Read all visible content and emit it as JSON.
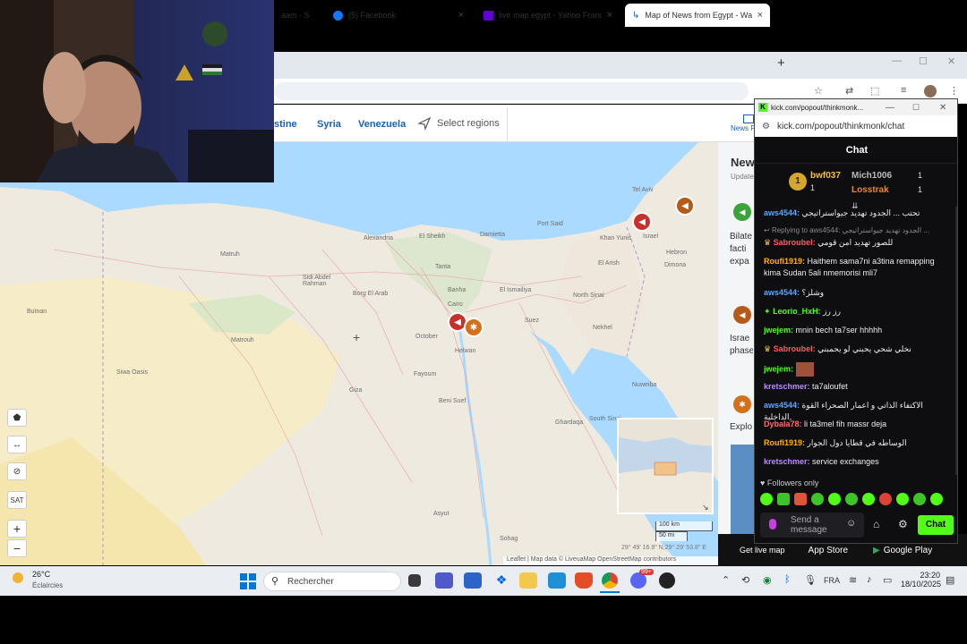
{
  "browser": {
    "tabs": [
      {
        "label": "aam · S",
        "active": false
      },
      {
        "label": "(5) Facebook",
        "active": false
      },
      {
        "label": "live map egypt - Yahoo France",
        "active": false
      },
      {
        "label": "Map of News from Egypt - Wa",
        "active": true
      }
    ],
    "new_tab": "+"
  },
  "liveuamap": {
    "nav": [
      "stine",
      "Syria",
      "Venezuela"
    ],
    "select_regions": "Select regions",
    "news_heading": "New",
    "news_tab": "News F",
    "news_items": [
      {
        "text": "Bilate facti expa"
      },
      {
        "text": "Israe phase"
      },
      {
        "text": "Explo"
      }
    ],
    "map_labels": [
      {
        "text": "Alexandria"
      },
      {
        "text": "El Sheikh"
      },
      {
        "text": "Damietta"
      },
      {
        "text": "Port Said"
      },
      {
        "text": "Tel Aviv"
      },
      {
        "text": "Khan Yunis"
      },
      {
        "text": "Israel"
      },
      {
        "text": "Hebron"
      },
      {
        "text": "Dimona"
      },
      {
        "text": "El Arish"
      },
      {
        "text": "Matruh"
      },
      {
        "text": "Sidi Abdel Rahman"
      },
      {
        "text": "Borg El Arab"
      },
      {
        "text": "Tanta"
      },
      {
        "text": "Banha"
      },
      {
        "text": "El Ismailiya"
      },
      {
        "text": "Suez"
      },
      {
        "text": "North Sinai"
      },
      {
        "text": "Nekhel"
      },
      {
        "text": "Cairo"
      },
      {
        "text": "October"
      },
      {
        "text": "Helwan"
      },
      {
        "text": "Matrouh"
      },
      {
        "text": "Siwa Oasis"
      },
      {
        "text": "Giza"
      },
      {
        "text": "Fayoum"
      },
      {
        "text": "Beni Suef"
      },
      {
        "text": "Ghardaqa"
      },
      {
        "text": "South Sinai"
      },
      {
        "text": "Nuweiba"
      },
      {
        "text": "Asyut"
      },
      {
        "text": "Sohag"
      },
      {
        "text": "Butnan"
      }
    ],
    "scale": {
      "km": "100 km",
      "mi": "50 mi"
    },
    "coordinates": "29° 49' 16.9\" N,29° 29' 53.8\" E",
    "attribution": "Leaflet | Map data © LiveuaMap OpenStreetMap contributors",
    "footer": {
      "get_live": "Get live map",
      "app_store": "App Store",
      "google_play": "Google Play"
    }
  },
  "chat_popup": {
    "window_title": "kick.com/popout/thinkmonk...",
    "url": "kick.com/popout/thinkmonk/chat",
    "header": "Chat",
    "leaderboard": [
      {
        "rank": "1",
        "name": "bwf037",
        "count": "1"
      },
      {
        "name": "Mich1006",
        "count": "1"
      },
      {
        "name": "Losstrak",
        "count": "1"
      }
    ],
    "messages": [
      {
        "user": "aws4544:",
        "text": "تحتب ... الجدود تهدید جيواستراتيجي",
        "color": "#5aa6ff"
      },
      {
        "user": "Replying to aws4544:",
        "text": "الجدود تهدید جيواستراتيجي ...",
        "color": "#8a8a8a"
      },
      {
        "user": "Sabroubel:",
        "text": "للصور تهدید امن قومي",
        "color": "#ff5c5c"
      },
      {
        "user": "Roufi1919:",
        "text": "Haithem sama7ni a3tina remapping kima Sudan 5ali nmemorisi mli7",
        "color": "#ffb000"
      },
      {
        "user": "aws4544:",
        "text": "وشلز؟",
        "color": "#5aa6ff"
      },
      {
        "user": "Leorio_HxH:",
        "text": "رز رز",
        "color": "#53fc18"
      },
      {
        "user": "jwejem:",
        "text": "mnin bech ta7ser hhhhh",
        "color": "#53fc18"
      },
      {
        "user": "Sabroubel:",
        "text": "نخلي شحي يحبني لو يحمبني",
        "color": "#ff5c5c"
      },
      {
        "user": "jwejem:",
        "text": "",
        "color": "#53fc18"
      },
      {
        "user": "kretschmer:",
        "text": "ta7aloufet",
        "color": "#b98cff"
      },
      {
        "user": "aws4544:",
        "text": "الاكتفاء الذاتي و اعمار الصحراء القوة الداخلية,",
        "color": "#5aa6ff"
      },
      {
        "user": "Dybala78:",
        "text": "li ta3mel fih massr deja",
        "color": "#ff6b6b"
      },
      {
        "user": "Roufi1919:",
        "text": "الوساطه في قطايا دول الجوار",
        "color": "#ffb000"
      },
      {
        "user": "kretschmer:",
        "text": "service exchanges",
        "color": "#b98cff"
      }
    ],
    "followers_only": "Followers only",
    "input_placeholder": "Send a message",
    "send_button": "Chat"
  },
  "taskbar": {
    "weather_temp": "26°C",
    "weather_desc": "Éclaircies",
    "search_placeholder": "Rechercher",
    "language": "FRA",
    "time": "23:20",
    "date": "18/10/2025",
    "badge": "99+"
  },
  "colors": {
    "accent_blue": "#1a5fb4",
    "kick_green": "#53fc18",
    "marker_red": "#c9302c",
    "marker_orange": "#d3701a"
  }
}
